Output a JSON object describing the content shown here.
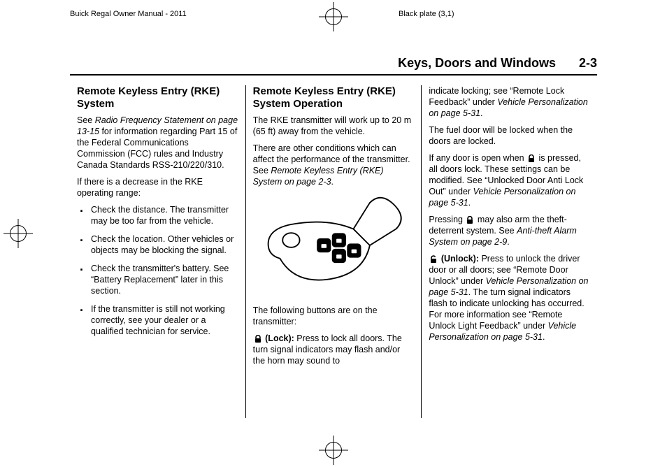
{
  "top": {
    "manual": "Buick Regal Owner Manual - 2011",
    "plate": "Black plate (3,1)"
  },
  "header": {
    "section": "Keys, Doors and Windows",
    "page": "2-3"
  },
  "col1": {
    "h": "Remote Keyless Entry (RKE) System",
    "p1a": "See ",
    "p1i": "Radio Frequency Statement on page 13-15",
    "p1b": " for information regarding Part 15 of the Federal Communications Commission (FCC) rules and Industry Canada Standards RSS-210/220/310.",
    "p2": "If there is a decrease in the RKE operating range:",
    "li1": "Check the distance. The transmitter may be too far from the vehicle.",
    "li2": "Check the location. Other vehicles or objects may be blocking the signal.",
    "li3": "Check the transmitter's battery. See “Battery Replacement” later in this section.",
    "li4": "If the transmitter is still not working correctly, see your dealer or a qualified technician for service."
  },
  "col2": {
    "h": "Remote Keyless Entry (RKE) System Operation",
    "p1": "The RKE transmitter will work up to 20 m (65 ft) away from the vehicle.",
    "p2a": "There are other conditions which can affect the performance of the transmitter. See ",
    "p2i": "Remote Keyless Entry (RKE) System on page 2-3",
    "p2b": ".",
    "p3": "The following buttons are on the transmitter:",
    "p4l": " (Lock):",
    "p4": "  Press to lock all doors. The turn signal indicators may flash and/or the horn may sound to"
  },
  "col3": {
    "p1a": "indicate locking; see “Remote Lock Feedback” under ",
    "p1i": "Vehicle Personalization on page 5-31",
    "p1b": ".",
    "p2": "The fuel door will be locked when the doors are locked.",
    "p3a": "If any door is open when ",
    "p3b": " is pressed, all doors lock. These settings can be modified. See “Unlocked Door Anti Lock Out” under ",
    "p3i": "Vehicle Personalization on page 5-31",
    "p3c": ".",
    "p4a": "Pressing ",
    "p4b": " may also arm the theft-deterrent system. See ",
    "p4i": "Anti-theft Alarm System on page 2-9",
    "p4c": ".",
    "p5l": " (Unlock):",
    "p5a": "  Press to unlock the driver door or all doors; see “Remote Door Unlock” under ",
    "p5i": "Vehicle Personalization on page 5-31",
    "p5b": ". The turn signal indicators flash to indicate unlocking has occurred. For more information see “Remote Unlock Light Feedback” under ",
    "p5i2": "Vehicle Personalization on page 5-31",
    "p5c": "."
  }
}
